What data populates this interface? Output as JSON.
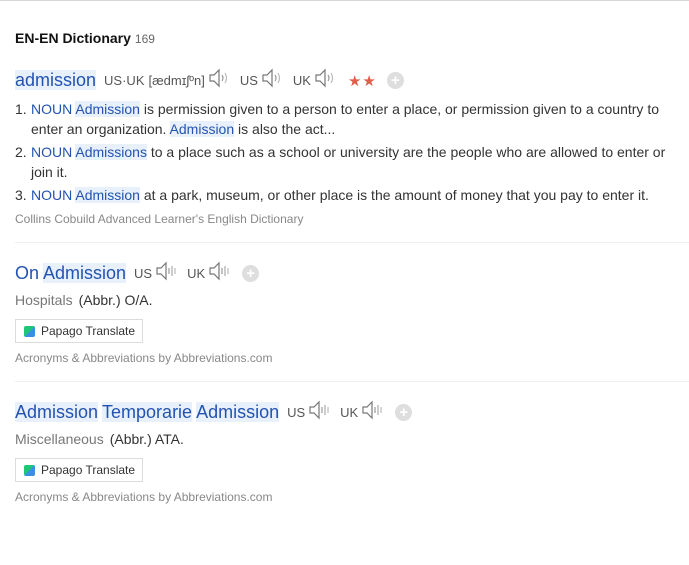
{
  "section": {
    "title": "EN-EN Dictionary",
    "count": "169"
  },
  "entry1": {
    "word": "admission",
    "pron_usuk_label": "US·UK",
    "pron_usuk_ipa": "[ædmɪʃºn]",
    "us_label": "US",
    "uk_label": "UK",
    "stars": "★★",
    "definitions": [
      {
        "num": "1.",
        "pos": "NOUN",
        "kw": "Admission",
        "text1": " is permission given to a person to enter a place, or permission given to a country to enter an organization. ",
        "kw2": "Admission",
        "text2": " is also the act..."
      },
      {
        "num": "2.",
        "pos": "NOUN",
        "kw": "Admissions",
        "text1": " to a place such as a school or university are the people who are allowed to enter or join it."
      },
      {
        "num": "3.",
        "pos": "NOUN",
        "kw": "Admission",
        "text1": " at a park, museum, or other place is the amount of money that you pay to enter it."
      }
    ],
    "source": "Collins Cobuild Advanced Learner's English Dictionary"
  },
  "entry2": {
    "word_part1": "On",
    "word_part2": "Admission",
    "us_label": "US",
    "uk_label": "UK",
    "category": "Hospitals",
    "abbr": "(Abbr.) O/A.",
    "papago_label": "Papago Translate",
    "source": "Acronyms & Abbreviations by Abbreviations.com"
  },
  "entry3": {
    "word_part1": "Admission",
    "word_part2": "Temporarie",
    "word_part3": "Admission",
    "us_label": "US",
    "uk_label": "UK",
    "category": "Miscellaneous",
    "abbr": "(Abbr.) ATA.",
    "papago_label": "Papago Translate",
    "source": "Acronyms & Abbreviations by Abbreviations.com"
  }
}
